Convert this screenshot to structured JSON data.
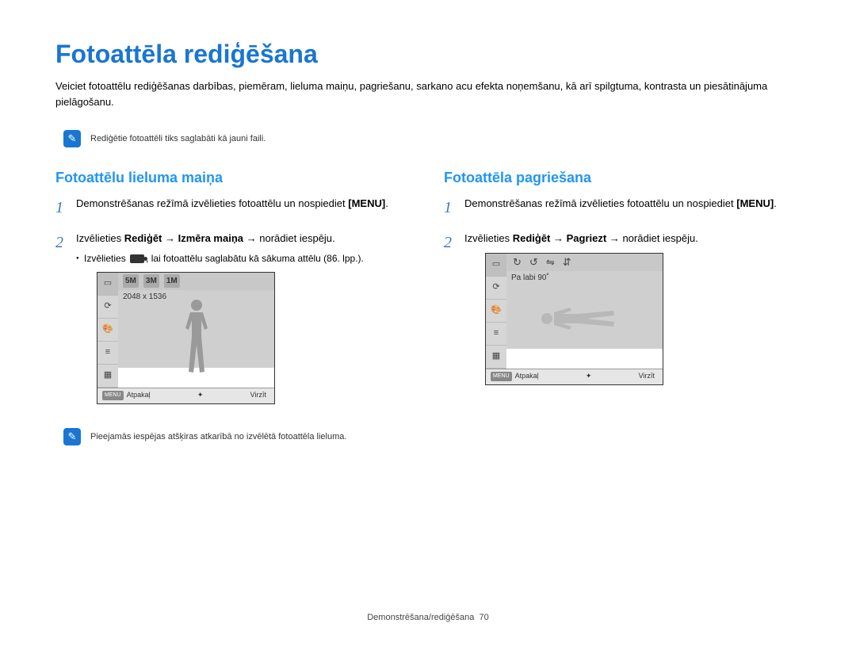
{
  "title": "Fotoattēla rediģēšana",
  "intro": "Veiciet fotoattēlu rediģēšanas darbības, piemēram, lieluma maiņu, pagriešanu, sarkano acu efekta noņemšanu, kā arī spilgtuma, kontrasta un piesātinājuma pielāgošanu.",
  "note1": "Rediģētie fotoattēli tiks saglabāti kā jauni faili.",
  "left": {
    "heading": "Fotoattēlu lieluma maiņa",
    "step1_pre": "Demonstrēšanas režīmā izvēlieties fotoattēlu un nospiediet ",
    "step1_btn": "[MENU]",
    "step1_post": ".",
    "step2_pre": "Izvēlieties ",
    "step2_b1": "Rediģēt",
    "step2_arrow1": " → ",
    "step2_b2": "Izmēra maiņa",
    "step2_arrow2": " → ",
    "step2_post": "norādiet iespēju.",
    "sub": "Izvēlieties       , lai fotoattēlu saglabātu kā sākuma attēlu (86. lpp.).",
    "screen": {
      "sizes": [
        "5M",
        "3M",
        "1M"
      ],
      "resolution": "2048 x 1536",
      "back": "Atpakaļ",
      "move": "Virzīt",
      "menu": "MENU"
    },
    "note2": "Pieejamās iespējas atšķiras atkarībā no izvēlētā fotoattēla lieluma."
  },
  "right": {
    "heading": "Fotoattēla pagriešana",
    "step1_pre": "Demonstrēšanas režīmā izvēlieties fotoattēlu un nospiediet ",
    "step1_btn": "[MENU]",
    "step1_post": ".",
    "step2_pre": "Izvēlieties ",
    "step2_b1": "Rediģēt",
    "step2_arrow1": " → ",
    "step2_b2": "Pagriezt",
    "step2_arrow2": " → ",
    "step2_post": "norādiet iespēju.",
    "screen": {
      "label": "Pa labi 90˚",
      "back": "Atpakaļ",
      "move": "Virzīt",
      "menu": "MENU"
    }
  },
  "footer": {
    "section": "Demonstrēšana/rediģēšana",
    "page": "70"
  },
  "icons": {
    "note": "✎",
    "nav": "✦"
  }
}
